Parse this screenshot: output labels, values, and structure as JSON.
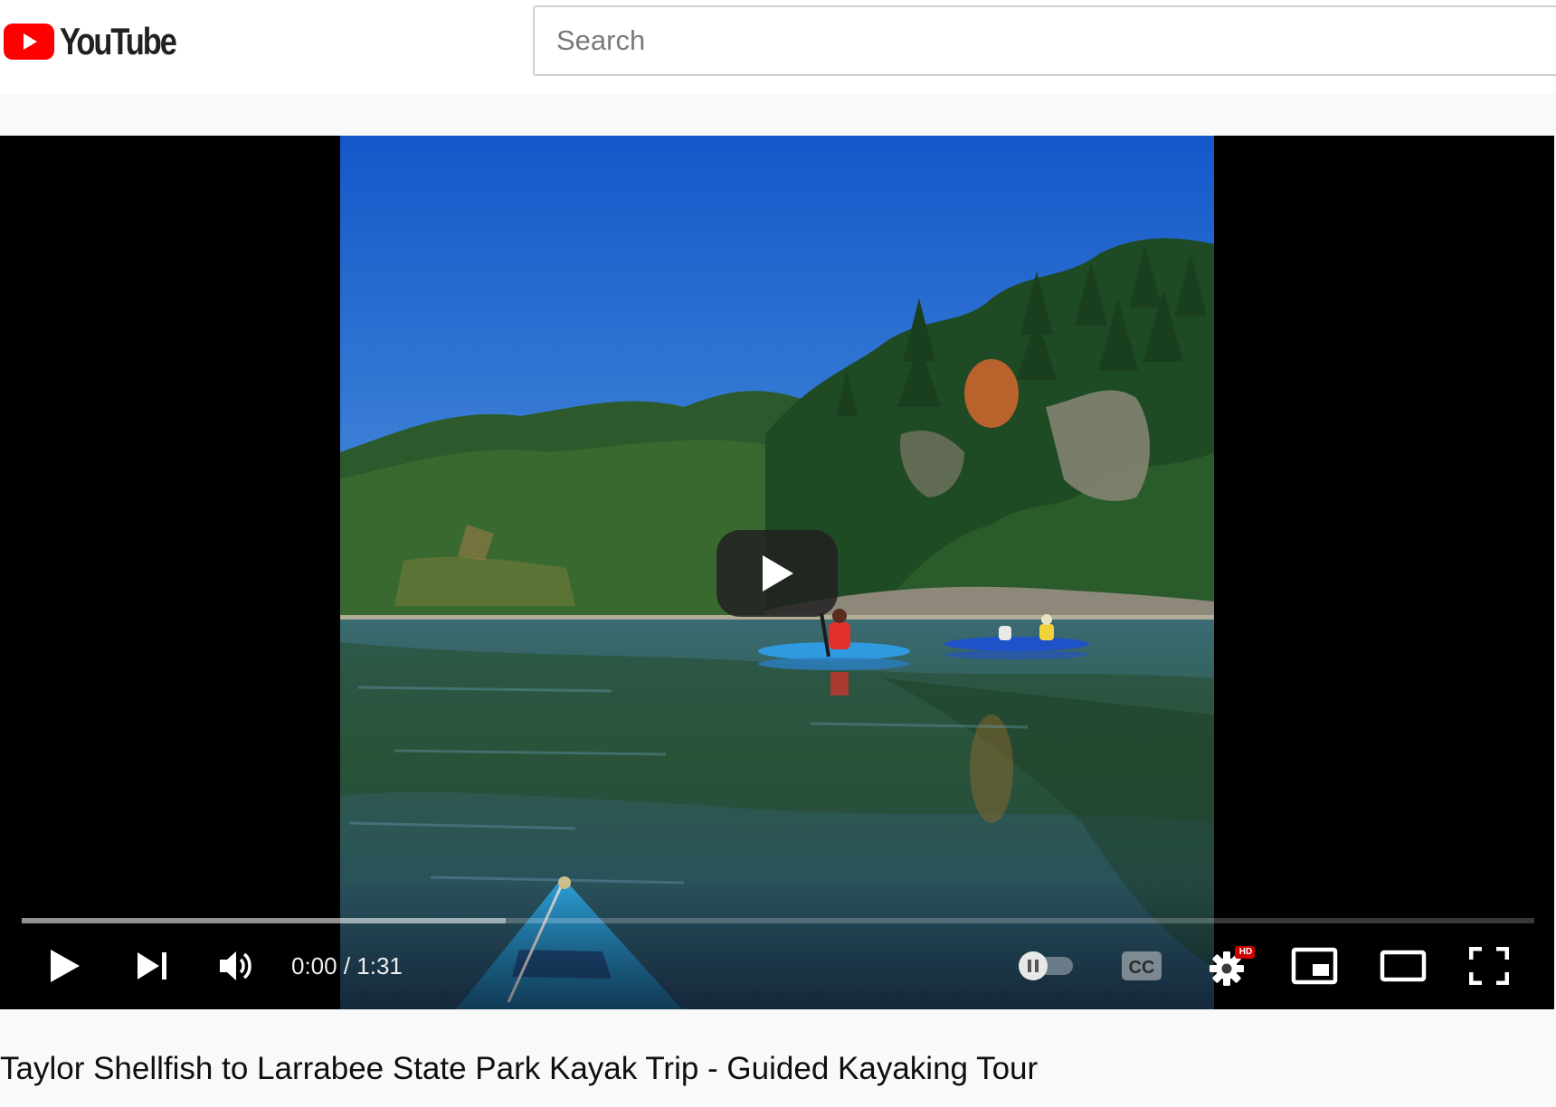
{
  "masthead": {
    "logo_text": "YouTube",
    "search": {
      "placeholder": "Search",
      "value": ""
    }
  },
  "player": {
    "current_time": "0:00",
    "time_separator": " / ",
    "duration": "1:31",
    "loaded_fraction": 0.32,
    "settings_badge": "HD",
    "colors": {
      "logo_red": "#ff0000",
      "settings_badge": "#cc0000"
    },
    "icons": [
      "play-icon",
      "next-icon",
      "volume-icon",
      "autoplay-toggle-icon",
      "captions-icon",
      "settings-icon",
      "miniplayer-icon",
      "theater-mode-icon",
      "fullscreen-icon"
    ]
  },
  "video": {
    "title": "Taylor Shellfish to Larrabee State Park Kayak Trip - Guided Kayaking Tour"
  }
}
